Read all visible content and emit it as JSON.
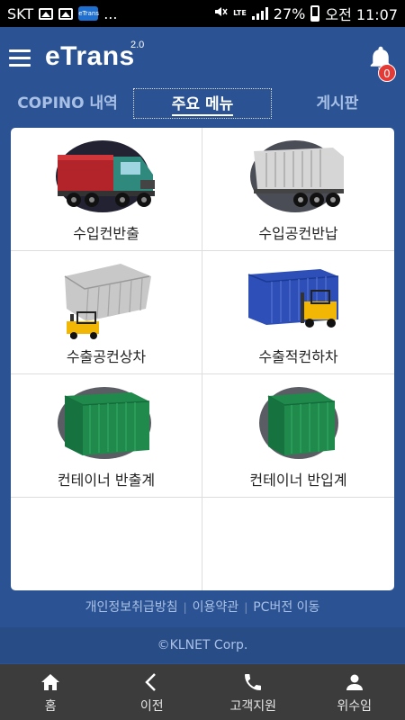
{
  "status_bar": {
    "carrier": "SKT",
    "more": "...",
    "app_icon_text": "eTrans",
    "network": "LTE",
    "battery": "27%",
    "time": "오전 11:07"
  },
  "header": {
    "logo": "eTrans",
    "version": "2.0",
    "notification_count": "0"
  },
  "tabs": [
    {
      "label": "COPINO 내역",
      "active": false
    },
    {
      "label": "주요 메뉴",
      "active": true
    },
    {
      "label": "게시판",
      "active": false
    }
  ],
  "menu": [
    {
      "label": "수입컨반출",
      "icon": "import-container-truck-icon"
    },
    {
      "label": "수입공컨반납",
      "icon": "empty-container-trailer-icon"
    },
    {
      "label": "수출공컨상차",
      "icon": "forklift-lifting-container-icon"
    },
    {
      "label": "수출적컨하차",
      "icon": "forklift-blue-container-icon"
    },
    {
      "label": "컨테이너 반출계",
      "icon": "green-container-icon"
    },
    {
      "label": "컨테이너 반입계",
      "icon": "green-container-icon"
    }
  ],
  "footer": {
    "links": [
      "개인정보취급방침",
      "이용약관",
      "PC버전 이동"
    ],
    "separator": "|",
    "copyright": "©KLNET Corp."
  },
  "bottom_nav": [
    {
      "label": "홈",
      "icon": "home-icon"
    },
    {
      "label": "이전",
      "icon": "back-chevron-icon"
    },
    {
      "label": "고객지원",
      "icon": "phone-icon"
    },
    {
      "label": "위수임",
      "icon": "person-icon"
    }
  ],
  "colors": {
    "primary": "#2b5393",
    "tab_inactive": "#a9c0e6",
    "badge": "#e53935",
    "bottom_nav": "#3c3c3c"
  }
}
